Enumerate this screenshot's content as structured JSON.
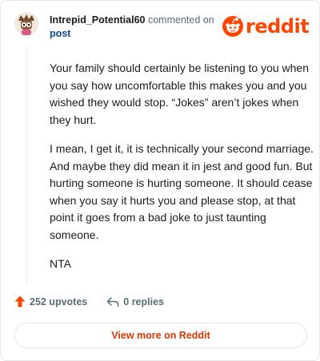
{
  "header": {
    "username": "Intrepid_Potential60",
    "action_text": "commented on",
    "post_link": "post",
    "brand": "reddit"
  },
  "comment": {
    "paragraphs": [
      "Your family should certainly be listening to you when you say how uncomfortable this makes you and you wished they would stop. “Jokes” aren’t jokes when they hurt.",
      "I mean, I get it, it is technically your second marriage. And maybe they did mean it in jest and good fun. But hurting someone is hurting someone. It should cease when you say it hurts you and please stop, at that point it goes from a bad joke to just taunting someone.",
      "NTA"
    ]
  },
  "actions": {
    "upvotes": "252 upvotes",
    "replies": "0 replies"
  },
  "footer": {
    "view_more": "View more on Reddit"
  },
  "colors": {
    "brand": "#ff4500",
    "link": "#0b4a8a",
    "muted": "#576f76",
    "cta": "#d93900"
  },
  "icons": {
    "avatar": "avatar-icon",
    "logo": "reddit-snoo-icon",
    "upvote": "upvote-arrow-icon",
    "reply": "reply-arrow-icon"
  }
}
